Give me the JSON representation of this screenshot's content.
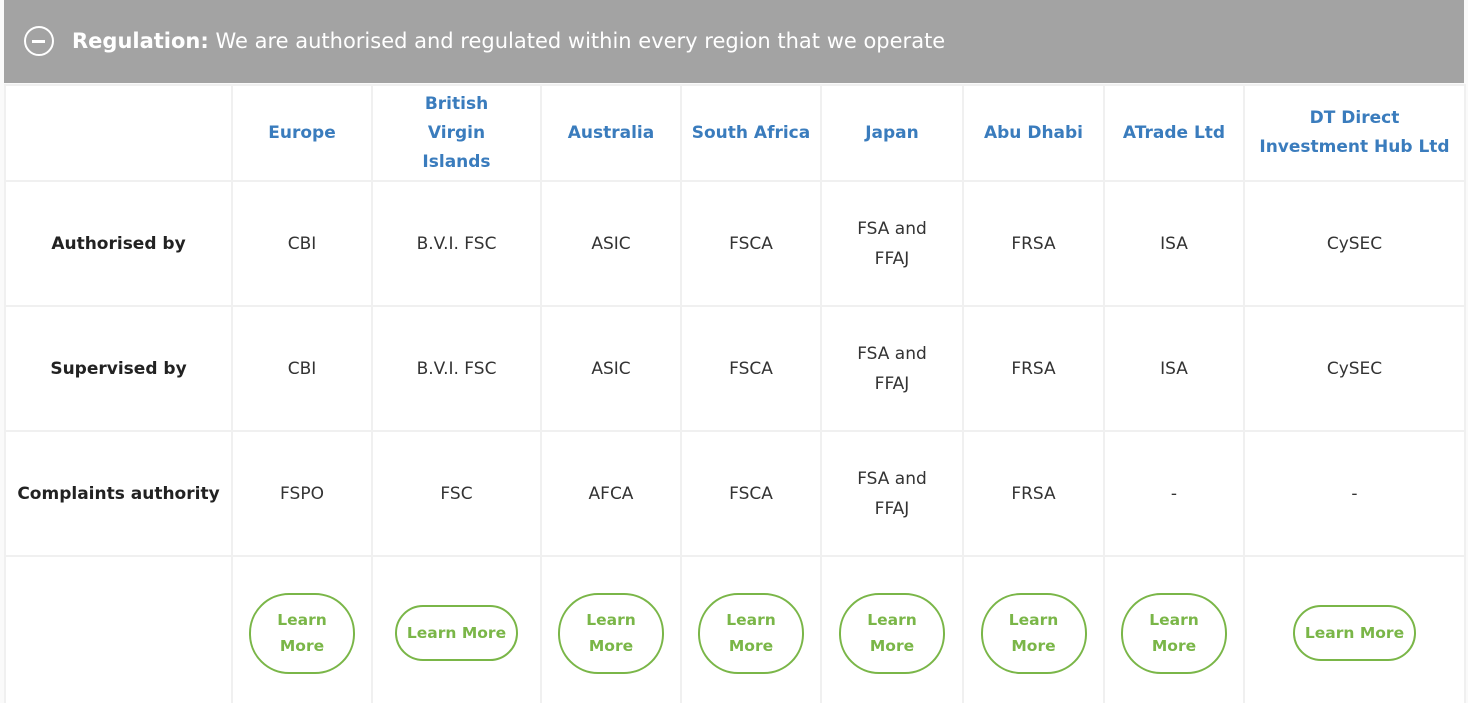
{
  "banner": {
    "title_bold": "Regulation:",
    "title_rest": " We are authorised and regulated within every region that we operate"
  },
  "columns": [
    "Europe",
    "British Virgin Islands",
    "Australia",
    "South Africa",
    "Japan",
    "Abu Dhabi",
    "ATrade Ltd",
    "DT Direct Investment Hub Ltd"
  ],
  "rows": [
    {
      "label": "Authorised by",
      "values": [
        "CBI",
        "B.V.I. FSC",
        "ASIC",
        "FSCA",
        "FSA and FFAJ",
        "FRSA",
        "ISA",
        "CySEC"
      ]
    },
    {
      "label": "Supervised by",
      "values": [
        "CBI",
        "B.V.I. FSC",
        "ASIC",
        "FSCA",
        "FSA and FFAJ",
        "FRSA",
        "ISA",
        "CySEC"
      ]
    },
    {
      "label": "Complaints authority",
      "values": [
        "FSPO",
        "FSC",
        "AFCA",
        "FSCA",
        "FSA and FFAJ",
        "FRSA",
        "-",
        "-"
      ]
    }
  ],
  "learn_more_label": "Learn More",
  "colors": {
    "banner": "#a3a3a3",
    "header_text": "#3a7cbd",
    "button": "#7ab648"
  },
  "icons": {
    "collapse": "minus-circle-icon"
  }
}
